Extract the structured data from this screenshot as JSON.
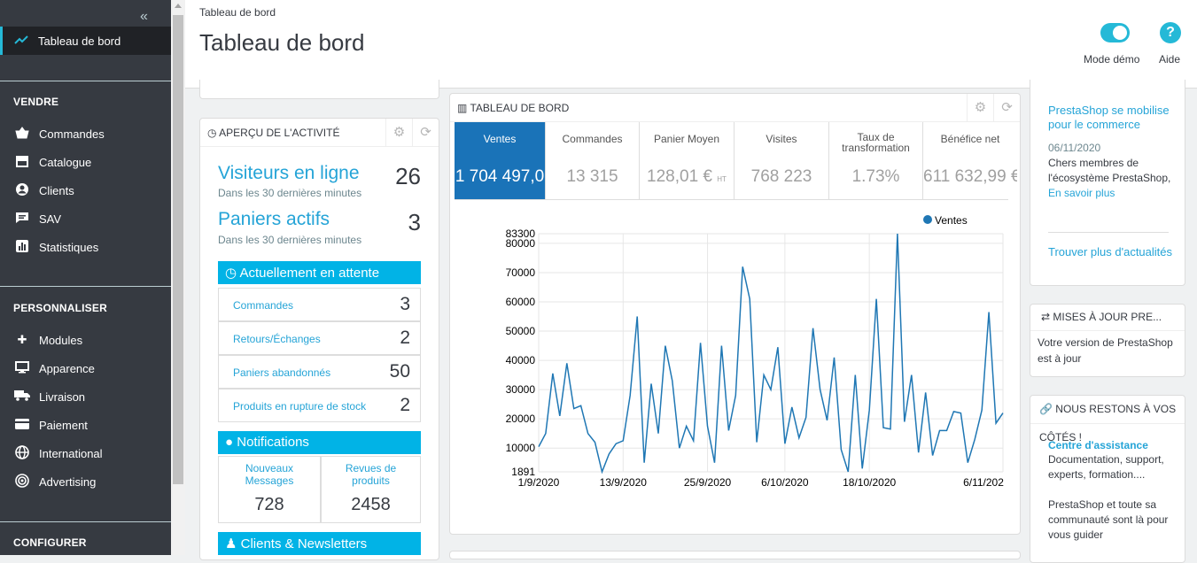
{
  "sidebar": {
    "collapse_icon": "«",
    "active": {
      "label": "Tableau de bord",
      "icon": "trending-up-icon"
    },
    "sections": [
      "VENDRE",
      "PERSONNALISER",
      "CONFIGURER"
    ],
    "vendre": [
      {
        "label": "Commandes",
        "icon": "basket-icon"
      },
      {
        "label": "Catalogue",
        "icon": "store-icon"
      },
      {
        "label": "Clients",
        "icon": "user-circle-icon"
      },
      {
        "label": "SAV",
        "icon": "chat-icon"
      },
      {
        "label": "Statistiques",
        "icon": "bar-chart-icon"
      }
    ],
    "personnaliser": [
      {
        "label": "Modules",
        "icon": "puzzle-icon"
      },
      {
        "label": "Apparence",
        "icon": "desktop-icon"
      },
      {
        "label": "Livraison",
        "icon": "truck-icon"
      },
      {
        "label": "Paiement",
        "icon": "credit-card-icon"
      },
      {
        "label": "International",
        "icon": "globe-icon"
      },
      {
        "label": "Advertising",
        "icon": "target-icon"
      }
    ]
  },
  "header": {
    "breadcrumb": "Tableau de bord",
    "title": "Tableau de bord",
    "demo_label": "Mode démo",
    "help_label": "Aide",
    "help_glyph": "?"
  },
  "activity": {
    "title": "APERÇU DE L'ACTIVITÉ",
    "visitors": {
      "label": "Visiteurs en ligne",
      "sub": "Dans les 30 dernières minutes",
      "value": "26"
    },
    "carts": {
      "label": "Paniers actifs",
      "sub": "Dans les 30 dernières minutes",
      "value": "3"
    },
    "pending": {
      "title": "Actuellement en attente",
      "rows": [
        {
          "label": "Commandes",
          "value": "3"
        },
        {
          "label": "Retours/Échanges",
          "value": "2"
        },
        {
          "label": "Paniers abandonnés",
          "value": "50"
        },
        {
          "label": "Produits en rupture de stock",
          "value": "2"
        }
      ]
    },
    "notifications": {
      "title": "Notifications",
      "cells": [
        {
          "label": "Nouveaux Messages",
          "value": "728"
        },
        {
          "label": "Revues de produits",
          "value": "2458"
        }
      ]
    },
    "clients_title": "Clients & Newsletters"
  },
  "dashboard": {
    "title": "TABLEAU DE BORD",
    "kpis": [
      {
        "label": "Ventes",
        "value": "1 704 497,0",
        "active": true
      },
      {
        "label": "Commandes",
        "value": "13 315"
      },
      {
        "label": "Panier Moyen",
        "value": "128,01 €",
        "suffix": "HT"
      },
      {
        "label": "Visites",
        "value": "768 223"
      },
      {
        "label": "Taux de transformation",
        "value": "1.73%"
      },
      {
        "label": "Bénéfice net",
        "value": "611 632,99 €"
      }
    ],
    "legend": "Ventes",
    "line_color": "#1f77b4"
  },
  "chart_data": {
    "type": "line",
    "series": [
      {
        "name": "Ventes",
        "values": [
          10500,
          15000,
          35500,
          21000,
          39000,
          23500,
          24500,
          15000,
          12000,
          1891,
          8000,
          11500,
          12500,
          28000,
          55000,
          5000,
          32000,
          15000,
          45000,
          33000,
          10000,
          17500,
          12500,
          46000,
          17500,
          5000,
          45000,
          16000,
          28000,
          72000,
          61000,
          12000,
          35000,
          30000,
          44500,
          11500,
          24000,
          13500,
          20500,
          51000,
          30000,
          19500,
          41000,
          9500,
          1891,
          35000,
          3000,
          23000,
          61000,
          17000,
          16500,
          83300,
          19000,
          35000,
          8500,
          29000,
          7500,
          16000,
          16000,
          22500,
          22000,
          5000,
          13000,
          23000,
          56500,
          18500,
          22000
        ]
      }
    ],
    "x_tick_labels": [
      "1/9/2020",
      "13/9/2020",
      "25/9/2020",
      "6/10/2020",
      "18/10/2020",
      "6/11/202"
    ],
    "y_ticks": [
      10000,
      20000,
      30000,
      40000,
      50000,
      60000,
      70000,
      80000
    ],
    "ylim": [
      1891,
      83300
    ],
    "grid": true,
    "legend": "top-right"
  },
  "news": {
    "title": "PrestaShop se mobilise pour le commerce",
    "date": "06/11/2020",
    "body": "Chers membres de l'écosystème PrestaShop,",
    "link": "En savoir plus",
    "more": "Trouver plus d'actualités"
  },
  "updates": {
    "title": "MISES À JOUR PRE...",
    "body": "Votre version de PrestaShop est à jour"
  },
  "contact": {
    "title": "NOUS RESTONS À VOS",
    "title2": "CÔTÉS !",
    "link": "Centre d'assistance",
    "body1": "Documentation, support, experts, formation....",
    "body2": "PrestaShop et toute sa communauté sont là pour vous guider"
  }
}
